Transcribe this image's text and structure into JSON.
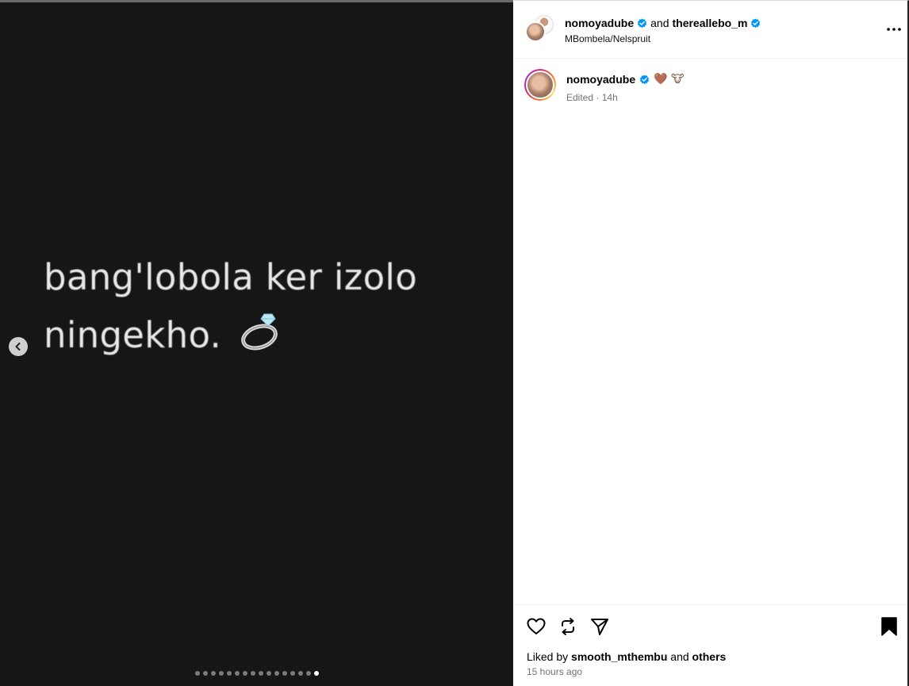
{
  "post": {
    "slide_text_line1": "bang'lobola ker izolo",
    "slide_text_line2": "ningekho.",
    "slide_count": 16,
    "active_slide": 16
  },
  "header": {
    "user1": "nomoyadube",
    "connector": "and",
    "user2": "thereallebo_m",
    "location": "MBombela/Nelspruit"
  },
  "caption": {
    "username": "nomoyadube",
    "emojis": "🤎 🐮",
    "edited": "Edited",
    "separator": "·",
    "time": "14h"
  },
  "footer": {
    "liked_by_prefix": "Liked by",
    "liked_by_user": "smooth_mthembu",
    "liked_by_and": "and",
    "liked_by_others": "others",
    "posted_ago": "15 hours ago"
  },
  "colors": {
    "verified_blue": "#0095f6",
    "slide_bg": "#161616",
    "meta_gray": "#737373"
  },
  "icons": {
    "prev": "chevron-left-icon",
    "more": "more-horizontal-icon",
    "like": "heart-icon",
    "repost": "repost-icon",
    "share": "send-icon",
    "save": "bookmark-filled-icon"
  }
}
